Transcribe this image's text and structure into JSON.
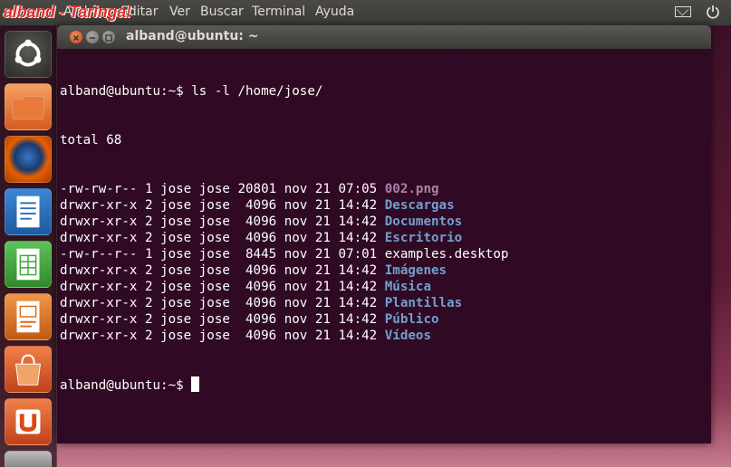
{
  "topbar": {
    "watermark": "alband - Taringa!",
    "menus": [
      "Archivo",
      "Editar",
      "Ver",
      "Buscar",
      "Terminal",
      "Ayuda"
    ],
    "indicators": [
      "mail-icon",
      "power-icon"
    ]
  },
  "launcher": {
    "items": [
      {
        "name": "ubuntu-logo-icon",
        "color": "#3c3b37"
      },
      {
        "name": "home-folder-icon",
        "color": "#e8753b"
      },
      {
        "name": "firefox-icon",
        "color": "#e66000"
      },
      {
        "name": "writer-icon",
        "color": "#2a6fbb"
      },
      {
        "name": "calc-icon",
        "color": "#3da83a"
      },
      {
        "name": "impress-icon",
        "color": "#d86d1b"
      },
      {
        "name": "software-center-icon",
        "color": "#e0572a"
      },
      {
        "name": "ubuntu-one-icon",
        "color": "#e0572a"
      },
      {
        "name": "settings-icon",
        "color": "#888888"
      }
    ]
  },
  "window": {
    "title": "alband@ubuntu: ~"
  },
  "terminal": {
    "prompt": "alband@ubuntu:~$",
    "command": " ls -l /home/jose/",
    "total": "total 68",
    "entries": [
      {
        "meta": "-rw-rw-r-- 1 jose jose 20801 nov 21 07:05 ",
        "name": "002.png",
        "kind": "img"
      },
      {
        "meta": "drwxr-xr-x 2 jose jose  4096 nov 21 14:42 ",
        "name": "Descargas",
        "kind": "dir"
      },
      {
        "meta": "drwxr-xr-x 2 jose jose  4096 nov 21 14:42 ",
        "name": "Documentos",
        "kind": "dir"
      },
      {
        "meta": "drwxr-xr-x 2 jose jose  4096 nov 21 14:42 ",
        "name": "Escritorio",
        "kind": "dir"
      },
      {
        "meta": "-rw-r--r-- 1 jose jose  8445 nov 21 07:01 ",
        "name": "examples.desktop",
        "kind": "plain"
      },
      {
        "meta": "drwxr-xr-x 2 jose jose  4096 nov 21 14:42 ",
        "name": "Imágenes",
        "kind": "dir"
      },
      {
        "meta": "drwxr-xr-x 2 jose jose  4096 nov 21 14:42 ",
        "name": "Música",
        "kind": "dir"
      },
      {
        "meta": "drwxr-xr-x 2 jose jose  4096 nov 21 14:42 ",
        "name": "Plantillas",
        "kind": "dir"
      },
      {
        "meta": "drwxr-xr-x 2 jose jose  4096 nov 21 14:42 ",
        "name": "Público",
        "kind": "dir"
      },
      {
        "meta": "drwxr-xr-x 2 jose jose  4096 nov 21 14:42 ",
        "name": "Vídeos",
        "kind": "dir"
      }
    ],
    "final_prompt": "alband@ubuntu:~$ "
  },
  "colors": {
    "terminal_bg": "#300a24",
    "directory": "#729fcf",
    "image_file": "#ad7fa8",
    "accent": "#dd4814"
  }
}
